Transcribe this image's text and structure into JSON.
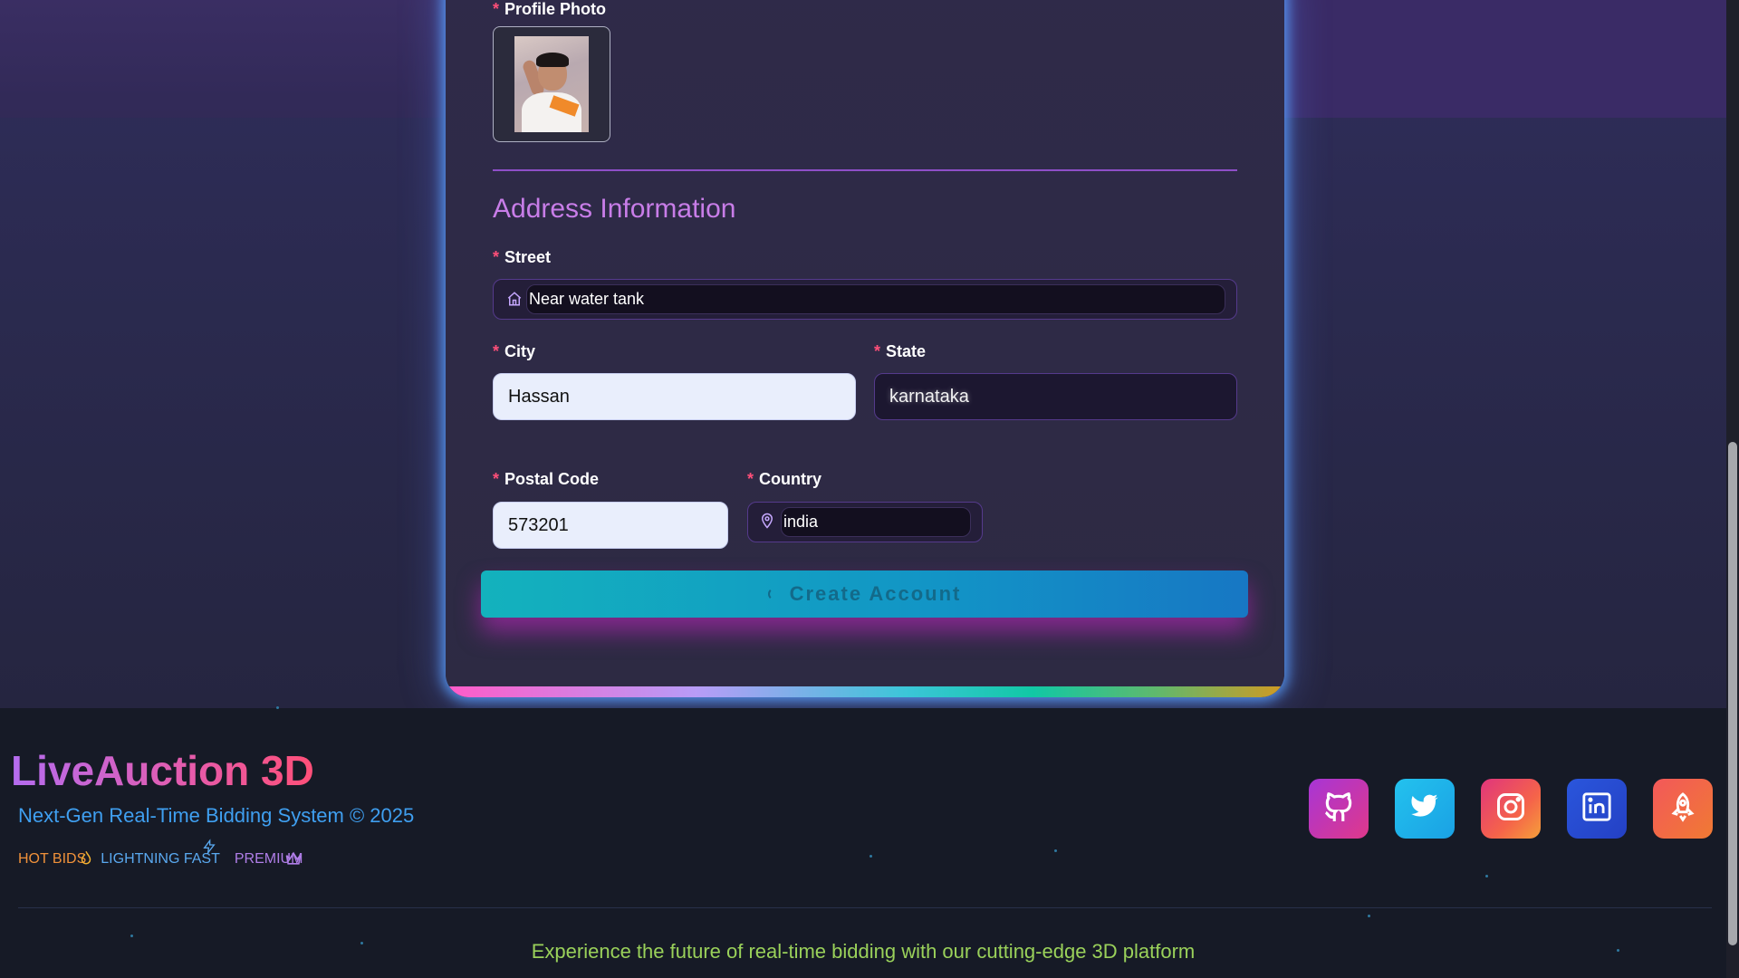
{
  "form": {
    "profile_photo_label": "Profile Photo",
    "required_marker": "*",
    "address_section_title": "Address Information",
    "street": {
      "label": "Street",
      "value": "Near water tank",
      "icon": "home-icon"
    },
    "city": {
      "label": "City",
      "value": "Hassan"
    },
    "state": {
      "label": "State",
      "value": "karnataka"
    },
    "postal_code": {
      "label": "Postal Code",
      "value": "573201"
    },
    "country": {
      "label": "Country",
      "value": "india",
      "icon": "map-pin-icon"
    },
    "submit_label": "Create Account"
  },
  "footer": {
    "brand": "LiveAuction 3D",
    "tagline": "Next-Gen Real-Time Bidding System © 2025",
    "badges": [
      {
        "label": "HOT BIDS",
        "icon": "flame-icon",
        "color": "#f0913a"
      },
      {
        "label": "LIGHTNING FAST",
        "icon": "lightning-icon",
        "color": "#5aa9f0"
      },
      {
        "label": "PREMIUM",
        "icon": "crown-icon",
        "color": "#b07ee8"
      }
    ],
    "social": [
      {
        "name": "github",
        "icon": "github-icon",
        "color": "#c23fc0"
      },
      {
        "name": "twitter",
        "icon": "twitter-icon",
        "color": "#1fb8ea"
      },
      {
        "name": "instagram",
        "icon": "instagram-icon",
        "color": "#f2445f"
      },
      {
        "name": "linkedin",
        "icon": "linkedin-icon",
        "color": "#2a4fd6"
      },
      {
        "name": "rocket",
        "icon": "rocket-icon",
        "color": "#f4535a"
      }
    ],
    "bottom_line": "Experience the future of real-time bidding with our cutting-edge 3D platform"
  }
}
